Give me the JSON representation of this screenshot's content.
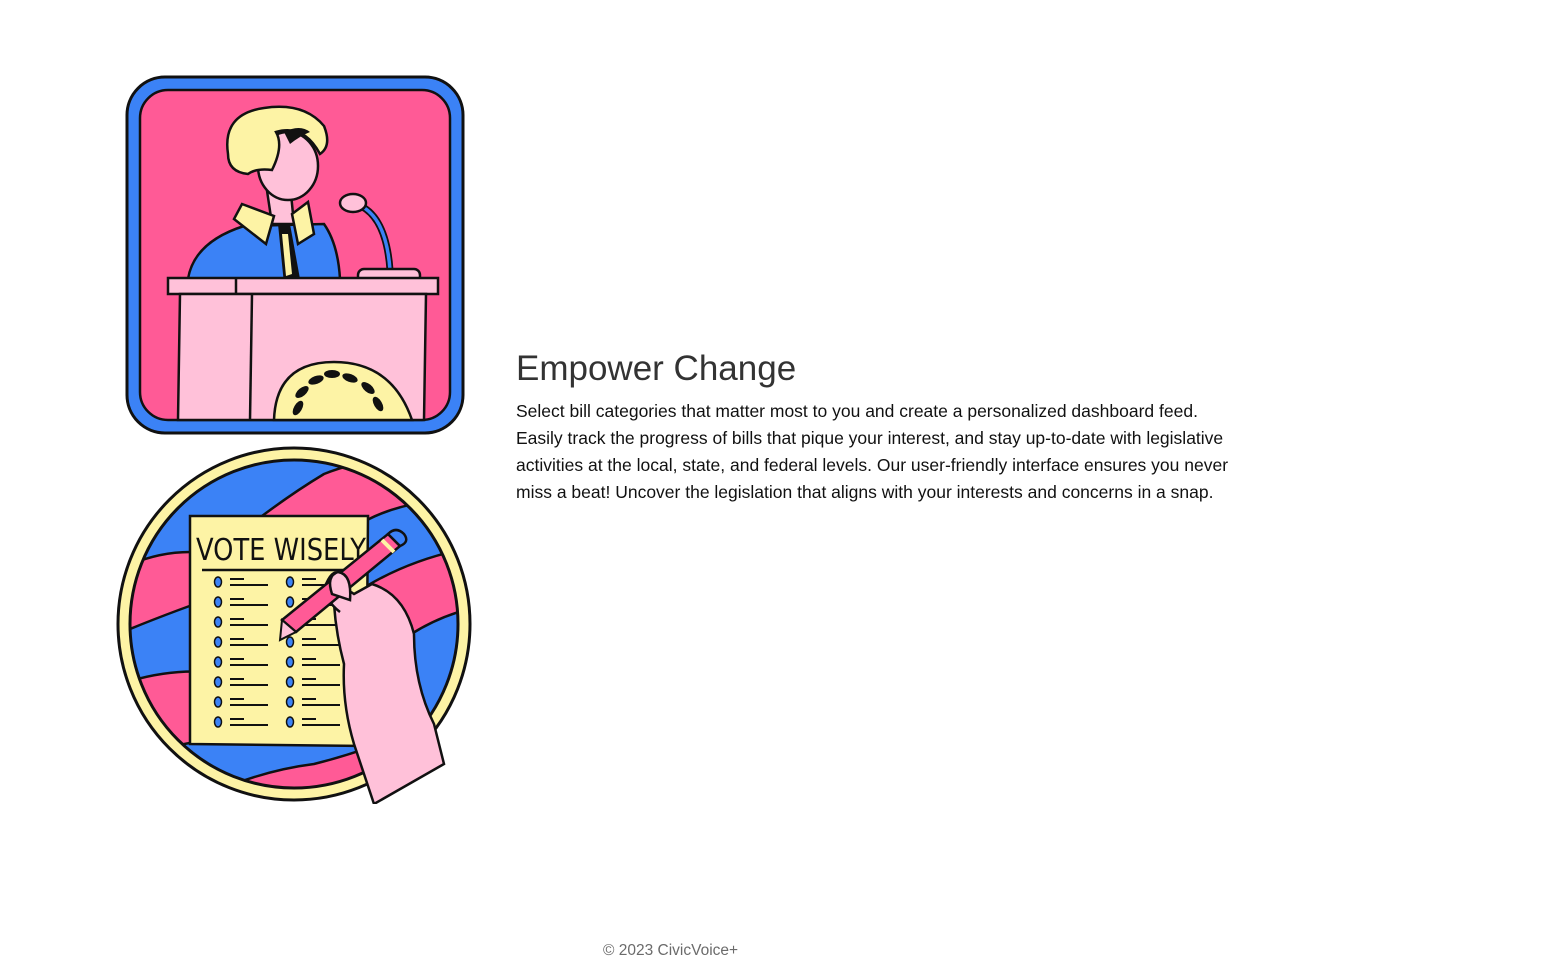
{
  "section": {
    "title": "Empower Change",
    "description": "Select bill categories that matter most to you and create a personalized dashboard feed. Easily track the progress of bills that pique your interest, and stay up-to-date with legislative activities at the local, state, and federal levels. Our user-friendly interface ensures you never miss a beat! Uncover the legislation that aligns with your interests and concerns in a snap."
  },
  "illustrations": {
    "ballot_heading": "VOTE WISELY"
  },
  "footer": {
    "copyright": "© 2023 CivicVoice+"
  },
  "colors": {
    "blue": "#3b82f6",
    "pink": "#ff5a96",
    "light_pink": "#ffc1d9",
    "yellow": "#fdf3a5",
    "outline": "#111111"
  }
}
